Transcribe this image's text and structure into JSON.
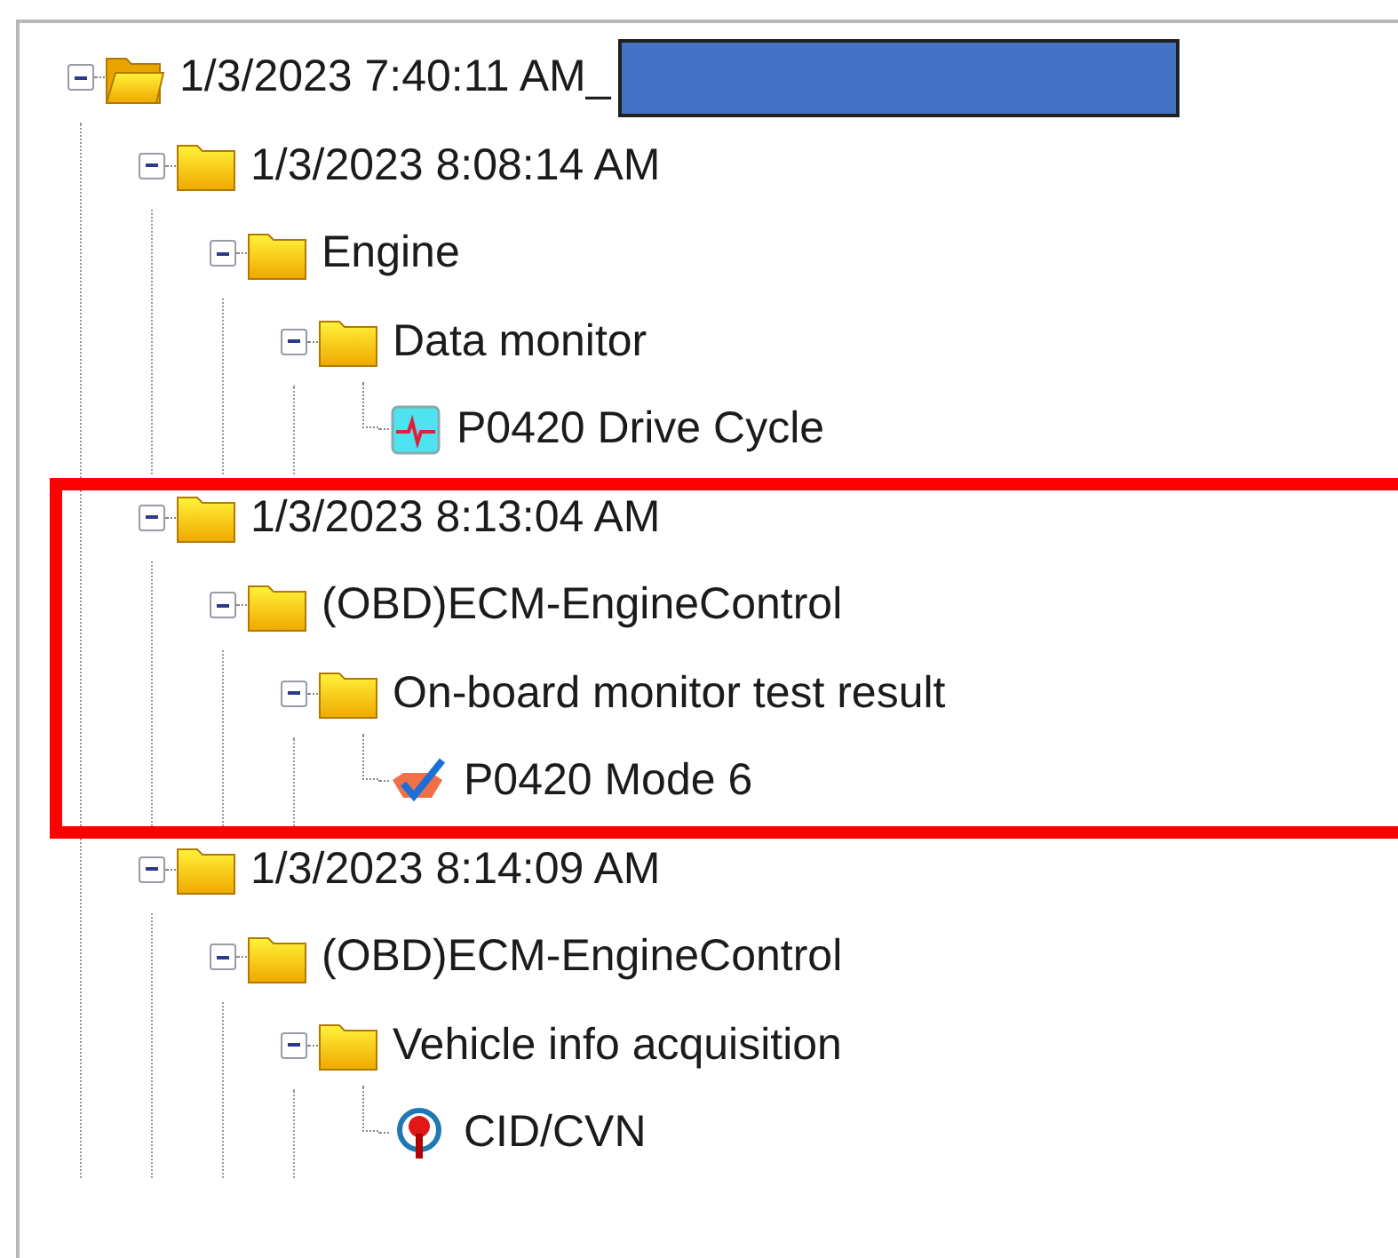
{
  "tree": [
    {
      "label": "1/3/2023 7:40:11 AM_",
      "kind": "open-folder",
      "expanded": true,
      "redacted": true,
      "children": [
        {
          "label": "1/3/2023 8:08:14 AM",
          "kind": "folder",
          "expanded": true,
          "children": [
            {
              "label": "Engine",
              "kind": "folder",
              "expanded": true,
              "children": [
                {
                  "label": "Data monitor",
                  "kind": "folder",
                  "expanded": true,
                  "children": [
                    {
                      "label": "P0420 Drive Cycle",
                      "kind": "graph"
                    }
                  ]
                }
              ]
            }
          ]
        },
        {
          "label": "1/3/2023 8:13:04 AM",
          "kind": "folder",
          "expanded": true,
          "highlighted": true,
          "children": [
            {
              "label": "(OBD)ECM-EngineControl",
              "kind": "folder",
              "expanded": true,
              "children": [
                {
                  "label": "On-board monitor test result",
                  "kind": "folder",
                  "expanded": true,
                  "children": [
                    {
                      "label": "P0420 Mode 6",
                      "kind": "test"
                    }
                  ]
                }
              ]
            }
          ]
        },
        {
          "label": "1/3/2023 8:14:09 AM",
          "kind": "folder",
          "expanded": true,
          "children": [
            {
              "label": "(OBD)ECM-EngineControl",
              "kind": "folder",
              "expanded": true,
              "children": [
                {
                  "label": "Vehicle info acquisition",
                  "kind": "folder",
                  "expanded": true,
                  "children": [
                    {
                      "label": "CID/CVN",
                      "kind": "sensor"
                    }
                  ]
                }
              ]
            }
          ]
        }
      ]
    }
  ]
}
